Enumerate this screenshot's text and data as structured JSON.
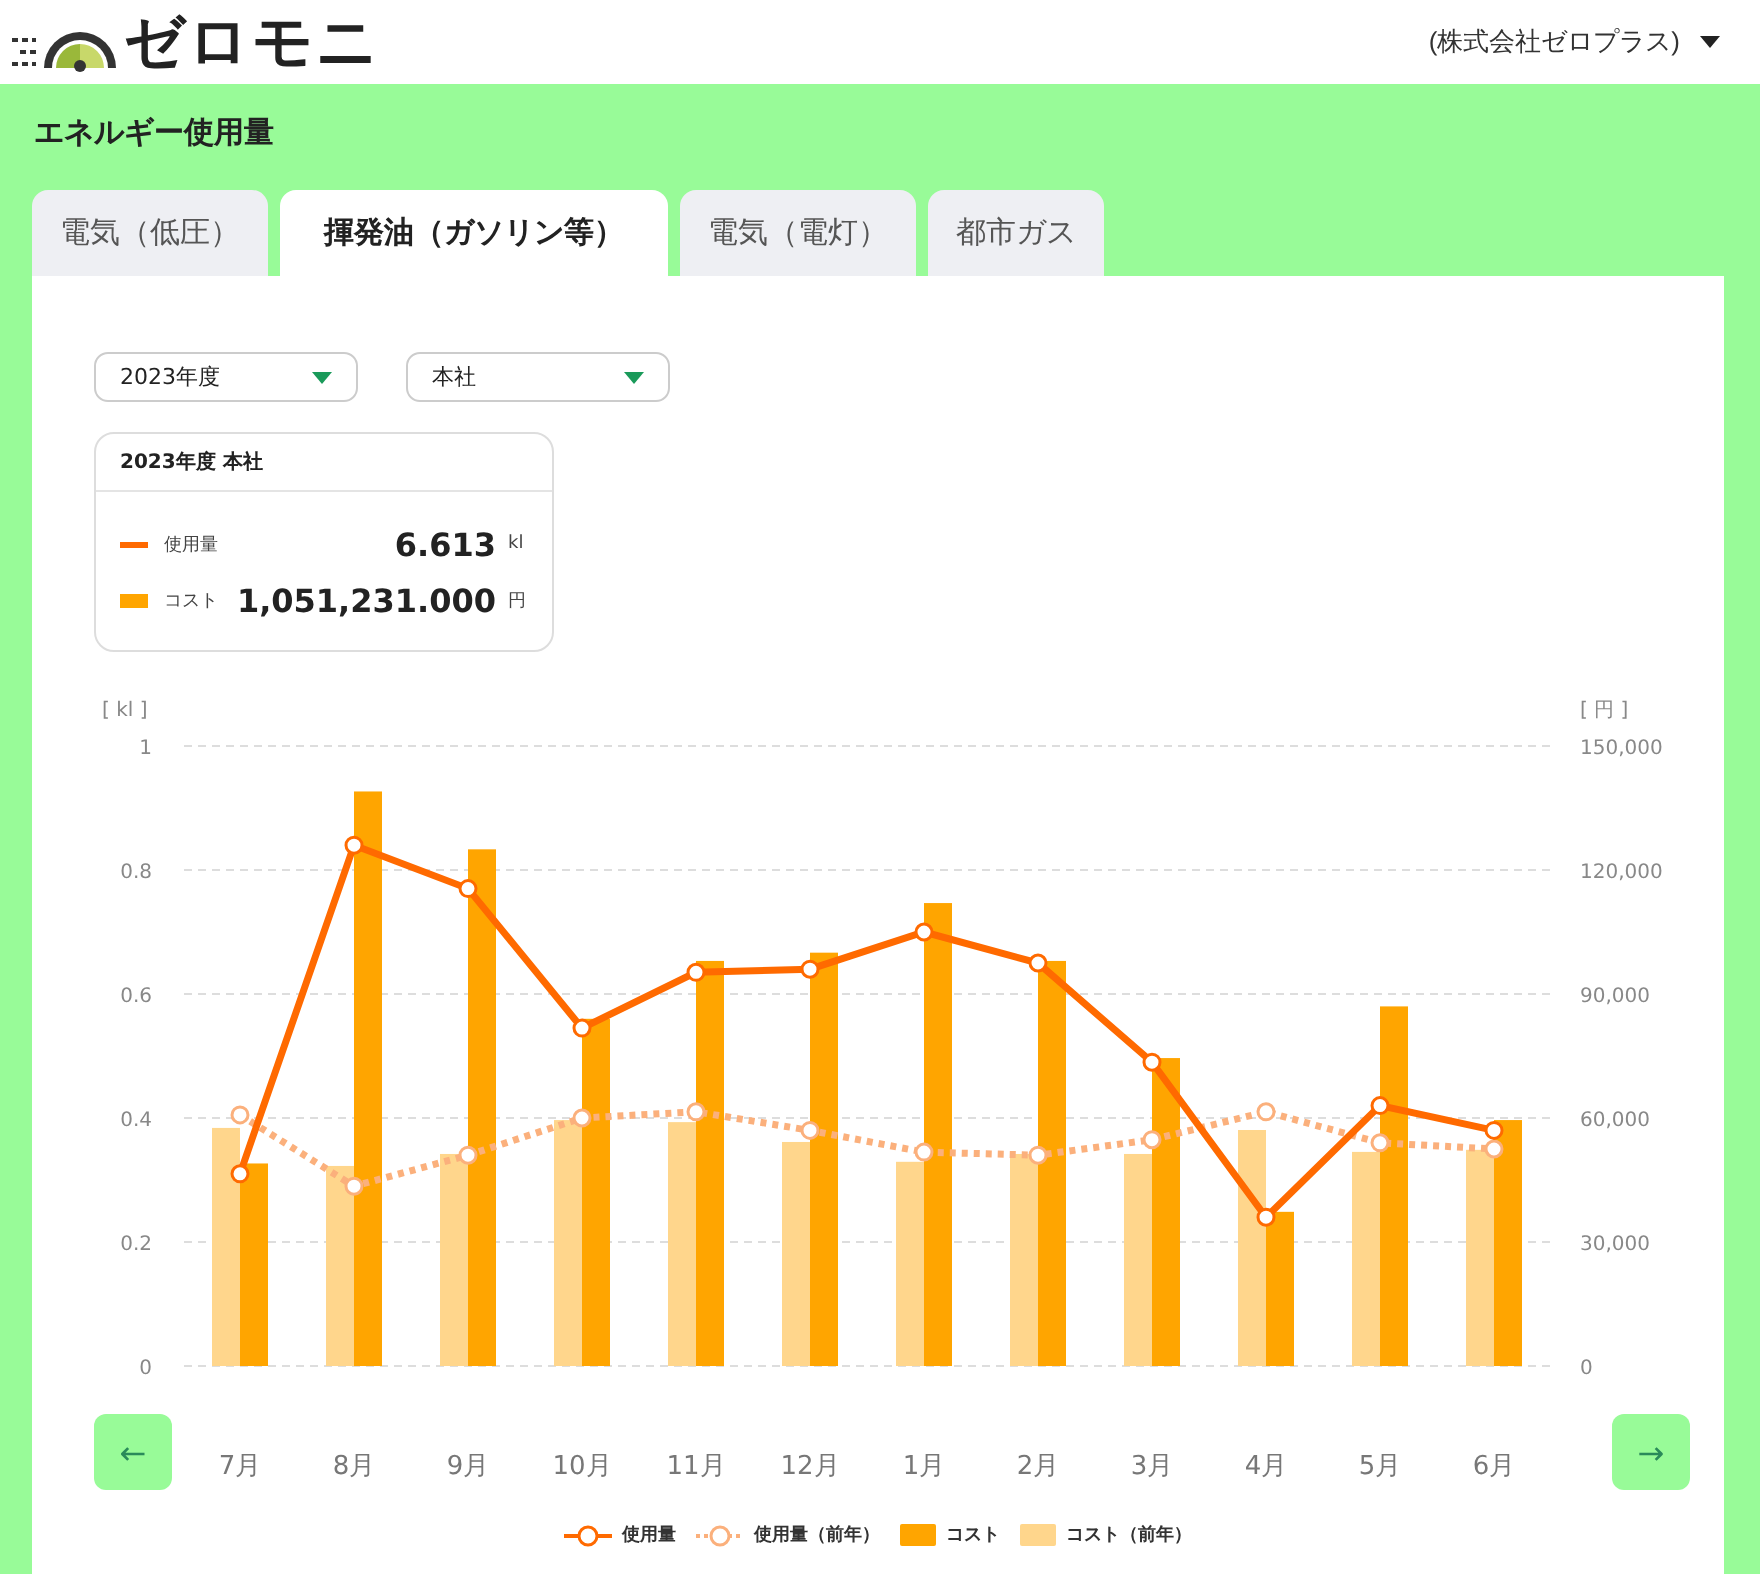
{
  "header": {
    "logo_text": "ゼロモニ",
    "company": "(株式会社ゼロプラス)"
  },
  "page_title": "エネルギー使用量",
  "tabs": [
    {
      "label": "電気（低圧）",
      "selected": false
    },
    {
      "label": "揮発油（ガソリン等）",
      "selected": true
    },
    {
      "label": "電気（電灯）",
      "selected": false
    },
    {
      "label": "都市ガス",
      "selected": false
    }
  ],
  "filters": [
    {
      "value": "2023年度"
    },
    {
      "value": "本社"
    }
  ],
  "summary": {
    "title": "2023年度 本社",
    "rows": [
      {
        "kind": "line",
        "label": "使用量",
        "value": "6.613",
        "unit": "kl",
        "color": "#ff6a00"
      },
      {
        "kind": "bar",
        "label": "コスト",
        "value": "1,051,231.000",
        "unit": "円",
        "color": "#ffa500"
      }
    ]
  },
  "cost_chart": {
    "chart_data": {
      "type": "bar",
      "ylabel": "[ 円 ]",
      "grid": true,
      "categories": [
        "7月",
        "8月",
        "9月",
        "10月",
        "11月",
        "12月",
        "1月",
        "2月",
        "3月",
        "4月",
        "5月",
        "6月"
      ],
      "ylim": [
        0,
        150000
      ],
      "yticks": [
        {
          "value": 0,
          "label": "0"
        },
        {
          "value": 30000,
          "label": "30,000"
        },
        {
          "value": 60000,
          "label": "60,000"
        },
        {
          "value": 90000,
          "label": "90,000"
        },
        {
          "value": 120000,
          "label": "120,000"
        },
        {
          "value": 150000,
          "label": "150,000"
        }
      ],
      "series": [
        {
          "name": "コスト",
          "color": "#ffa500",
          "values": [
            49000,
            139000,
            125000,
            84000,
            98000,
            100000,
            112000,
            98000,
            74500,
            37300,
            87000,
            59500
          ]
        },
        {
          "name": "コスト（前年）",
          "color": "#ffd68c",
          "values": [
            57600,
            48400,
            51300,
            59500,
            59000,
            54200,
            49400,
            51300,
            51300,
            57100,
            51800,
            52300
          ]
        }
      ]
    }
  },
  "usage_chart": {
    "chart_data": {
      "type": "line",
      "ylabel": "[ kl ]",
      "ylim": [
        0,
        1
      ],
      "yticks": [
        0,
        0.2,
        0.4,
        0.6,
        0.8,
        1
      ],
      "series": [
        {
          "name": "使用量",
          "color": "#ff6a00",
          "marker": "o",
          "values": [
            0.31,
            0.84,
            0.77,
            0.545,
            0.635,
            0.64,
            0.7,
            0.65,
            0.49,
            0.24,
            0.42,
            0.38
          ]
        },
        {
          "name": "使用量（前年）",
          "color": "#fbb07c",
          "line_style": "dotted",
          "marker": "o",
          "values": [
            0.405,
            0.29,
            0.34,
            0.4,
            0.41,
            0.38,
            0.345,
            0.34,
            0.365,
            0.41,
            0.36,
            0.35
          ]
        }
      ]
    }
  },
  "nav": {
    "prev": "←",
    "next": "→"
  }
}
